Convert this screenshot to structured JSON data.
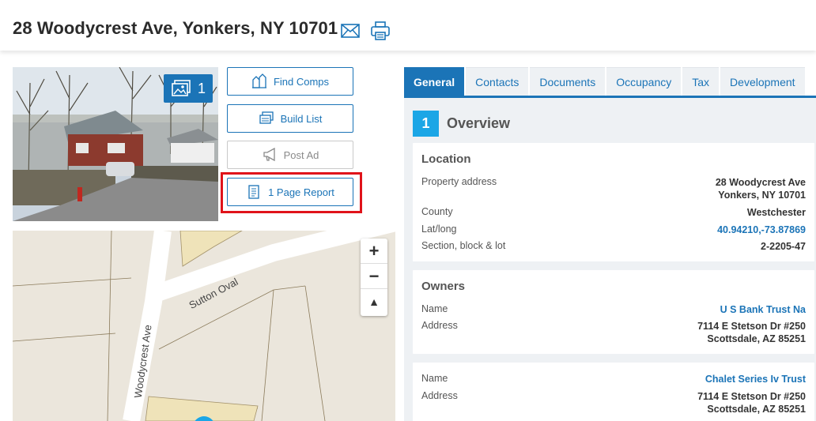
{
  "header": {
    "title": "28 Woodycrest Ave, Yonkers, NY 10701"
  },
  "photo": {
    "count": "1"
  },
  "actions": {
    "find_comps": "Find Comps",
    "build_list": "Build List",
    "post_ad": "Post Ad",
    "one_page_report": "1 Page Report"
  },
  "map": {
    "streets": [
      "Sutton Oval",
      "Woodycrest Ave"
    ],
    "zoom_in": "+",
    "zoom_out": "−",
    "reset_north": "▲"
  },
  "tabs": [
    "General",
    "Contacts",
    "Documents",
    "Occupancy",
    "Tax",
    "Development"
  ],
  "overview": {
    "number": "1",
    "title": "Overview"
  },
  "location": {
    "heading": "Location",
    "property_address_label": "Property address",
    "property_address_line1": "28 Woodycrest Ave",
    "property_address_line2": "Yonkers, NY 10701",
    "county_label": "County",
    "county": "Westchester",
    "latlong_label": "Lat/long",
    "latlong": "40.94210,-73.87869",
    "sbl_label": "Section, block & lot",
    "sbl": "2-2205-47"
  },
  "owners": {
    "heading": "Owners",
    "list": [
      {
        "name_label": "Name",
        "name": "U S Bank Trust Na",
        "address_label": "Address",
        "address_line1": "7114 E Stetson Dr #250",
        "address_line2": "Scottsdale, AZ 85251"
      },
      {
        "name_label": "Name",
        "name": "Chalet Series Iv Trust",
        "address_label": "Address",
        "address_line1": "7114 E Stetson Dr #250",
        "address_line2": "Scottsdale, AZ 85251"
      }
    ]
  },
  "colors": {
    "accent": "#1b74b7",
    "section_badge": "#1ba6e6",
    "highlight": "#e0131a"
  }
}
